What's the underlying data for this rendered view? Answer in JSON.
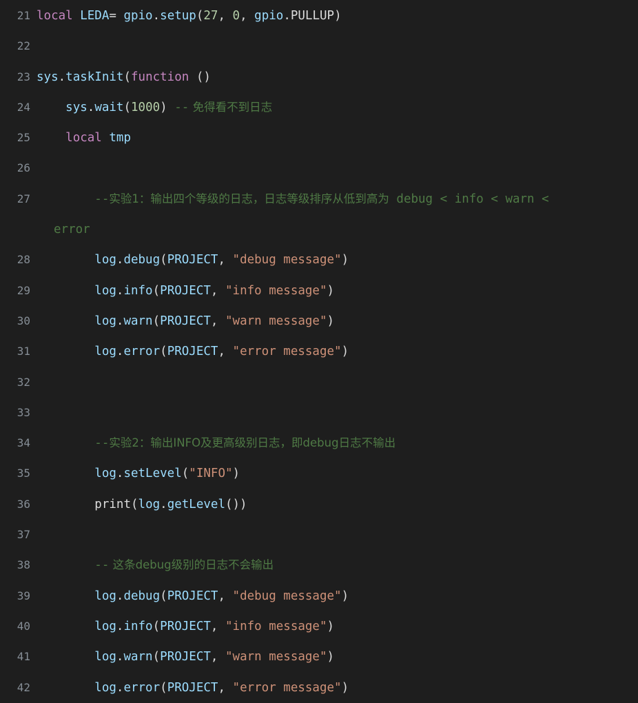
{
  "editor": {
    "background_color": "#1e1e1e",
    "gutter_color": "#868e96",
    "language": "lua",
    "first_visible_line": 21,
    "last_visible_line": 42
  },
  "theme": {
    "keyword": "#c586c0",
    "identifier": "#9cdcfe",
    "function": "#9cdcfe",
    "plain": "#dcdcdc",
    "number": "#b5cea8",
    "string": "#ce9178",
    "comment": "#4f7a45"
  },
  "lines": [
    {
      "number": "21",
      "text": "local LEDA= gpio.setup(27, 0, gpio.PULLUP)",
      "tokens": {
        "kw_local": "local",
        "ident_leda": " LEDA",
        "op_eq": "= ",
        "ns_gpio": "gpio",
        "dot1": ".",
        "fn_setup": "setup",
        "paren_open": "(",
        "num_27": "27",
        "comma1": ", ",
        "num_0": "0",
        "comma2": ", ",
        "ns_gpio2": "gpio",
        "dot2": ".",
        "const_pullup": "PULLUP",
        "paren_close": ")"
      }
    },
    {
      "number": "22",
      "text": ""
    },
    {
      "number": "23",
      "text": "sys.taskInit(function ()",
      "tokens": {
        "ns_sys": "sys",
        "dot1": ".",
        "fn_taskinit": "taskInit",
        "paren_open": "(",
        "kw_function": "function",
        "space_parens": " ()"
      }
    },
    {
      "number": "24",
      "text": "    sys.wait(1000) -- 免得看不到日志",
      "tokens": {
        "indent": "    ",
        "ns_sys": "sys",
        "dot1": ".",
        "fn_wait": "wait",
        "paren_open": "(",
        "num_1000": "1000",
        "paren_close": ")",
        "comment_dashes": " --",
        "comment_text": " 免得看不到日志"
      }
    },
    {
      "number": "25",
      "text": "    local tmp",
      "tokens": {
        "indent": "    ",
        "kw_local": "local",
        "ident_tmp": " tmp"
      }
    },
    {
      "number": "26",
      "text": ""
    },
    {
      "number": "27",
      "text": "        --实验1：输出四个等级的日志，日志等级排序从低到高为 debug < info < warn < error",
      "wrapped": true,
      "tokens": {
        "indent": "        ",
        "comment_dashes": "--",
        "comment_cjk": "实验1：输出四个等级的日志，日志等级排序从低到高为",
        "comment_levels": " debug < info < warn <",
        "comment_continuation": "error"
      }
    },
    {
      "number": "28",
      "text": "        log.debug(PROJECT, \"debug message\")",
      "tokens": {
        "indent": "        ",
        "ns_log": "log",
        "dot1": ".",
        "fn_debug": "debug",
        "paren_open": "(",
        "ident_project": "PROJECT",
        "comma": ", ",
        "str_msg": "\"debug message\"",
        "paren_close": ")"
      }
    },
    {
      "number": "29",
      "text": "        log.info(PROJECT, \"info message\")",
      "tokens": {
        "indent": "        ",
        "ns_log": "log",
        "dot1": ".",
        "fn_info": "info",
        "paren_open": "(",
        "ident_project": "PROJECT",
        "comma": ", ",
        "str_msg": "\"info message\"",
        "paren_close": ")"
      }
    },
    {
      "number": "30",
      "text": "        log.warn(PROJECT, \"warn message\")",
      "tokens": {
        "indent": "        ",
        "ns_log": "log",
        "dot1": ".",
        "fn_warn": "warn",
        "paren_open": "(",
        "ident_project": "PROJECT",
        "comma": ", ",
        "str_msg": "\"warn message\"",
        "paren_close": ")"
      }
    },
    {
      "number": "31",
      "text": "        log.error(PROJECT, \"error message\")",
      "tokens": {
        "indent": "        ",
        "ns_log": "log",
        "dot1": ".",
        "fn_error": "error",
        "paren_open": "(",
        "ident_project": "PROJECT",
        "comma": ", ",
        "str_msg": "\"error message\"",
        "paren_close": ")"
      }
    },
    {
      "number": "32",
      "text": ""
    },
    {
      "number": "33",
      "text": ""
    },
    {
      "number": "34",
      "text": "        --实验2：输出INFO及更高级别日志，即debug日志不输出",
      "tokens": {
        "indent": "        ",
        "comment_dashes": "--",
        "comment_cjk": "实验2：输出INFO及更高级别日志，即debug日志不输出"
      }
    },
    {
      "number": "35",
      "text": "        log.setLevel(\"INFO\")",
      "tokens": {
        "indent": "        ",
        "ns_log": "log",
        "dot1": ".",
        "fn_setlevel": "setLevel",
        "paren_open": "(",
        "str_info": "\"INFO\"",
        "paren_close": ")"
      }
    },
    {
      "number": "36",
      "text": "        print(log.getLevel())",
      "tokens": {
        "indent": "        ",
        "fn_print": "print",
        "paren_open": "(",
        "ns_log": "log",
        "dot1": ".",
        "fn_getlevel": "getLevel",
        "parens_close": "())"
      }
    },
    {
      "number": "37",
      "text": ""
    },
    {
      "number": "38",
      "text": "        -- 这条debug级别的日志不会输出",
      "tokens": {
        "indent": "        ",
        "comment_dashes": "--",
        "comment_cjk": " 这条debug级别的日志不会输出"
      }
    },
    {
      "number": "39",
      "text": "        log.debug(PROJECT, \"debug message\")",
      "tokens": {
        "indent": "        ",
        "ns_log": "log",
        "dot1": ".",
        "fn_debug": "debug",
        "paren_open": "(",
        "ident_project": "PROJECT",
        "comma": ", ",
        "str_msg": "\"debug message\"",
        "paren_close": ")"
      }
    },
    {
      "number": "40",
      "text": "        log.info(PROJECT, \"info message\")",
      "tokens": {
        "indent": "        ",
        "ns_log": "log",
        "dot1": ".",
        "fn_info": "info",
        "paren_open": "(",
        "ident_project": "PROJECT",
        "comma": ", ",
        "str_msg": "\"info message\"",
        "paren_close": ")"
      }
    },
    {
      "number": "41",
      "text": "        log.warn(PROJECT, \"warn message\")",
      "tokens": {
        "indent": "        ",
        "ns_log": "log",
        "dot1": ".",
        "fn_warn": "warn",
        "paren_open": "(",
        "ident_project": "PROJECT",
        "comma": ", ",
        "str_msg": "\"warn message\"",
        "paren_close": ")"
      }
    },
    {
      "number": "42",
      "text": "        log.error(PROJECT, \"error message\")",
      "tokens": {
        "indent": "        ",
        "ns_log": "log",
        "dot1": ".",
        "fn_error": "error",
        "paren_open": "(",
        "ident_project": "PROJECT",
        "comma": ", ",
        "str_msg": "\"error message\"",
        "paren_close": ")"
      }
    }
  ]
}
